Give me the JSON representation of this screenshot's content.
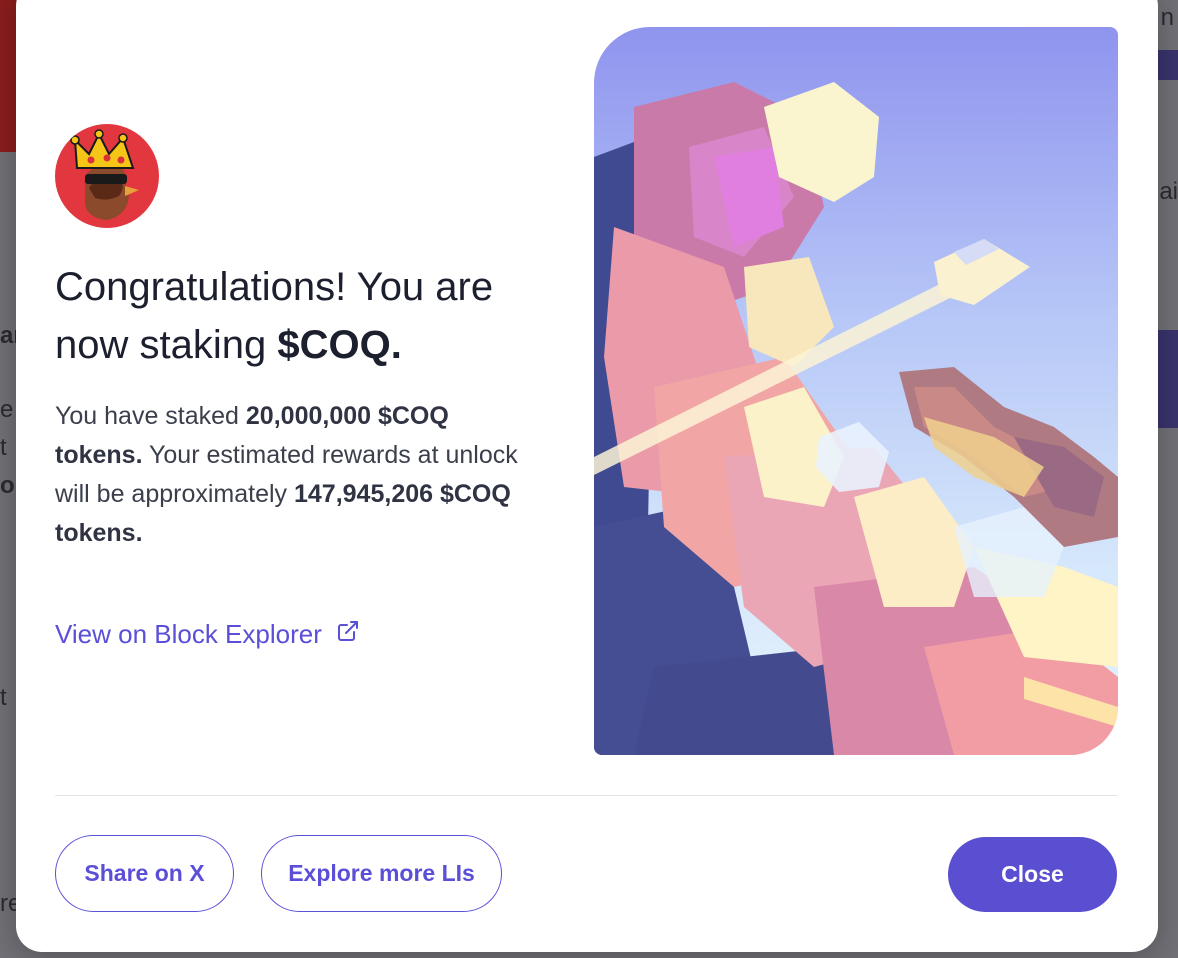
{
  "modal": {
    "headline": {
      "lead": "Congratulations! You are now staking ",
      "token": "$COQ."
    },
    "body": {
      "p1": "You have staked ",
      "staked_amount": "20,000,000 $COQ tokens.",
      "p2": " Your estimated rewards at unlock will be approximately ",
      "reward_amount": "147,945,206 $COQ tokens."
    },
    "explorer_link": {
      "label": "View on Block Explorer",
      "icon": "external-link-icon"
    },
    "buttons": {
      "share": "Share on X",
      "explore": "Explore more LIs",
      "close": "Close"
    },
    "avatar_icon": "coq-crowned-rooster-avatar"
  },
  "background_fragments": {
    "right_top": "n",
    "right_mid": "ai",
    "left_1": "ar",
    "left_2": "e",
    "left_3": "t",
    "left_4": "o",
    "left_5": "t",
    "left_6": "re"
  },
  "colors": {
    "accent": "#5a4fd6",
    "close_button": "#5a4fd0",
    "avatar_bg": "#e2373f",
    "text_dark": "#1c1f2e",
    "text_body": "#3b3f4c"
  }
}
